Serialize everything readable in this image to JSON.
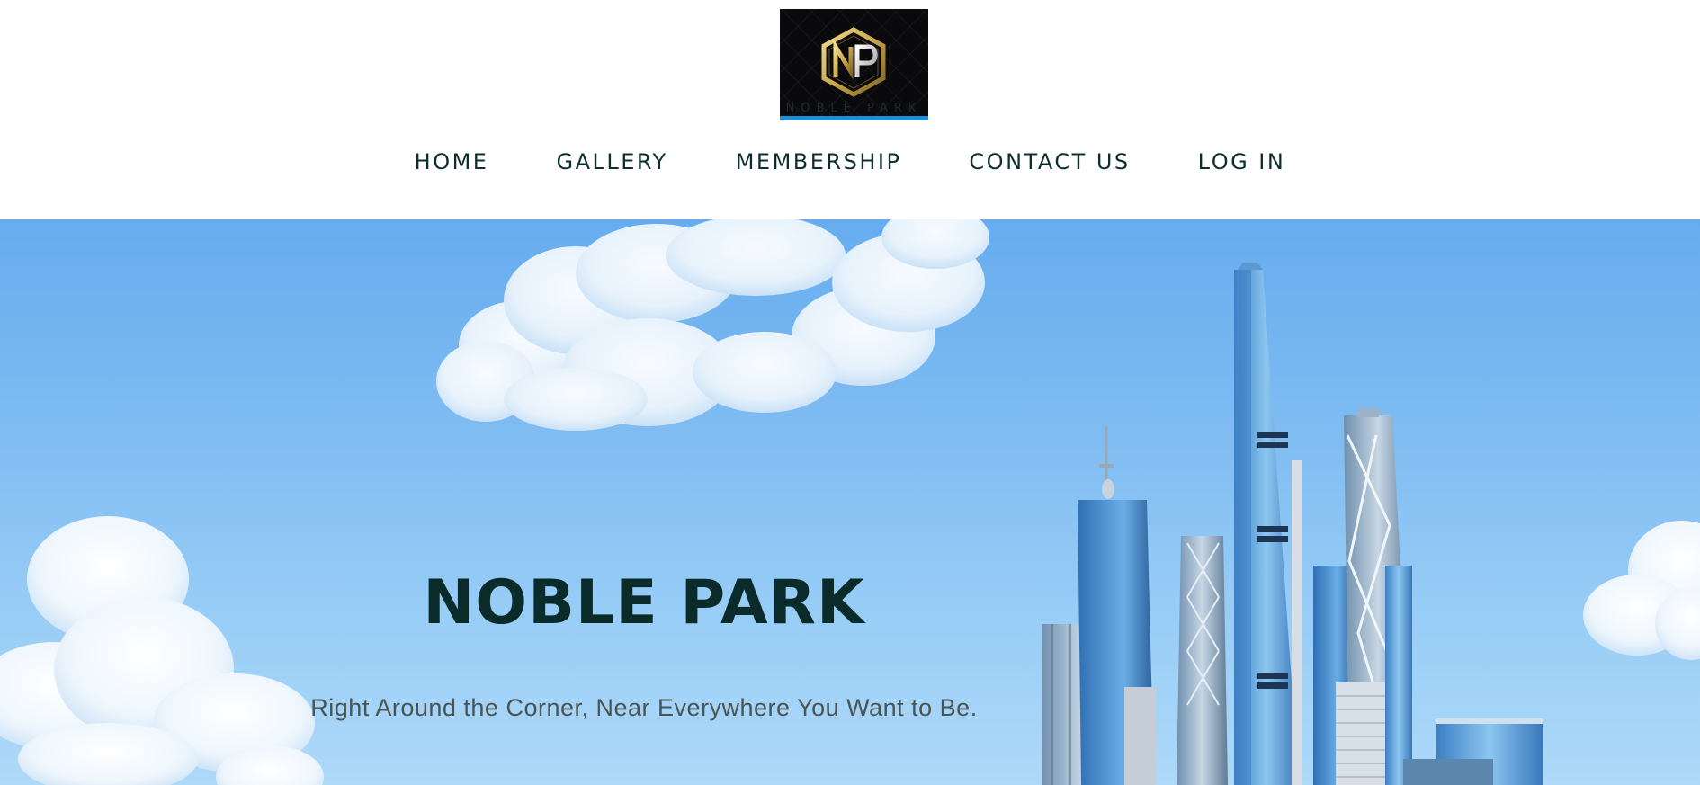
{
  "brand": {
    "logo_monogram": "NP",
    "logo_wordmark": "NOBLE PARK",
    "colors": {
      "logo_bg": "#0a0a0c",
      "logo_gold": "#c9a74a",
      "logo_bar": "#1e8fd6",
      "nav_text": "#0f2f2f",
      "hero_title": "#0b2b2b",
      "hero_subtitle": "#4a5454",
      "sky": "#7fbcf2"
    }
  },
  "nav": {
    "items": [
      {
        "label": "HOME"
      },
      {
        "label": "GALLERY"
      },
      {
        "label": "MEMBERSHIP"
      },
      {
        "label": "CONTACT US"
      },
      {
        "label": "LOG IN"
      }
    ]
  },
  "hero": {
    "title": "NOBLE PARK",
    "subtitle": "Right Around the Corner, Near Everywhere You Want to Be."
  }
}
